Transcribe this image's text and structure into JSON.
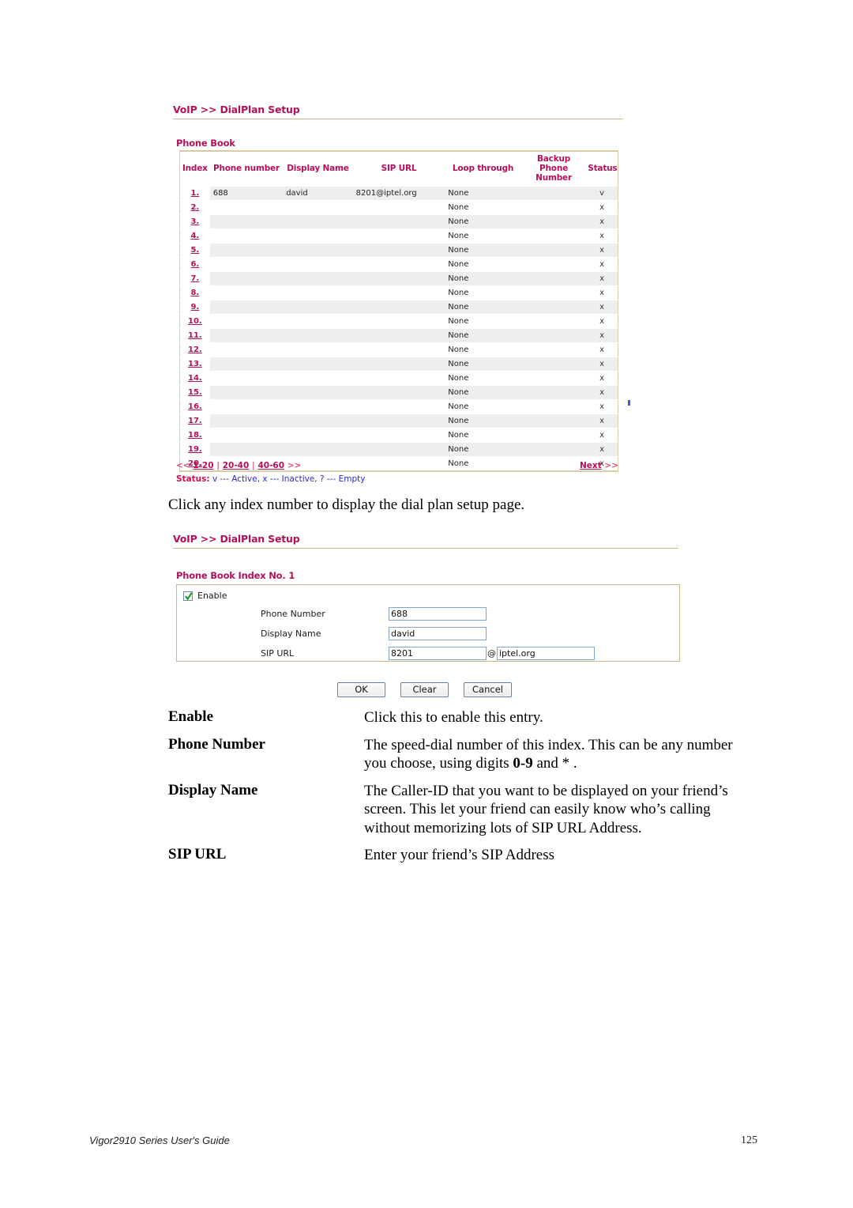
{
  "document": {
    "footer_title": "Vigor2910 Series User's Guide",
    "page_number": "125",
    "instruction": "Click any index number to display the dial plan setup page."
  },
  "list_screen": {
    "breadcrumb": "VoIP >> DialPlan Setup",
    "section_title": "Phone Book",
    "columns": [
      "Index",
      "Phone number",
      "Display Name",
      "SIP URL",
      "Loop through",
      "Backup Phone Number",
      "Status"
    ],
    "rows": [
      {
        "index": "1.",
        "phone": "688",
        "display": "david",
        "sip": "8201@iptel.org",
        "loop": "None",
        "backup": "",
        "status": "v"
      },
      {
        "index": "2.",
        "phone": "",
        "display": "",
        "sip": "",
        "loop": "None",
        "backup": "",
        "status": "x"
      },
      {
        "index": "3.",
        "phone": "",
        "display": "",
        "sip": "",
        "loop": "None",
        "backup": "",
        "status": "x"
      },
      {
        "index": "4.",
        "phone": "",
        "display": "",
        "sip": "",
        "loop": "None",
        "backup": "",
        "status": "x"
      },
      {
        "index": "5.",
        "phone": "",
        "display": "",
        "sip": "",
        "loop": "None",
        "backup": "",
        "status": "x"
      },
      {
        "index": "6.",
        "phone": "",
        "display": "",
        "sip": "",
        "loop": "None",
        "backup": "",
        "status": "x"
      },
      {
        "index": "7.",
        "phone": "",
        "display": "",
        "sip": "",
        "loop": "None",
        "backup": "",
        "status": "x"
      },
      {
        "index": "8.",
        "phone": "",
        "display": "",
        "sip": "",
        "loop": "None",
        "backup": "",
        "status": "x"
      },
      {
        "index": "9.",
        "phone": "",
        "display": "",
        "sip": "",
        "loop": "None",
        "backup": "",
        "status": "x"
      },
      {
        "index": "10.",
        "phone": "",
        "display": "",
        "sip": "",
        "loop": "None",
        "backup": "",
        "status": "x"
      },
      {
        "index": "11.",
        "phone": "",
        "display": "",
        "sip": "",
        "loop": "None",
        "backup": "",
        "status": "x"
      },
      {
        "index": "12.",
        "phone": "",
        "display": "",
        "sip": "",
        "loop": "None",
        "backup": "",
        "status": "x"
      },
      {
        "index": "13.",
        "phone": "",
        "display": "",
        "sip": "",
        "loop": "None",
        "backup": "",
        "status": "x"
      },
      {
        "index": "14.",
        "phone": "",
        "display": "",
        "sip": "",
        "loop": "None",
        "backup": "",
        "status": "x"
      },
      {
        "index": "15.",
        "phone": "",
        "display": "",
        "sip": "",
        "loop": "None",
        "backup": "",
        "status": "x"
      },
      {
        "index": "16.",
        "phone": "",
        "display": "",
        "sip": "",
        "loop": "None",
        "backup": "",
        "status": "x"
      },
      {
        "index": "17.",
        "phone": "",
        "display": "",
        "sip": "",
        "loop": "None",
        "backup": "",
        "status": "x"
      },
      {
        "index": "18.",
        "phone": "",
        "display": "",
        "sip": "",
        "loop": "None",
        "backup": "",
        "status": "x"
      },
      {
        "index": "19.",
        "phone": "",
        "display": "",
        "sip": "",
        "loop": "None",
        "backup": "",
        "status": "x"
      },
      {
        "index": "20.",
        "phone": "",
        "display": "",
        "sip": "",
        "loop": "None",
        "backup": "",
        "status": "x"
      }
    ],
    "pager": {
      "prev": "<<",
      "page1": "1-20",
      "page2": "20-40",
      "page3": "40-60",
      "more": ">>",
      "sep": "|",
      "next_label": "Next",
      "next_arrows": ">>"
    },
    "status_legend": {
      "label": "Status:",
      "text": "v --- Active, x --- Inactive, ? --- Empty"
    }
  },
  "detail_screen": {
    "breadcrumb": "VoIP >> DialPlan Setup",
    "section_title": "Phone Book Index No. 1",
    "enable_label": "Enable",
    "enable_checked": true,
    "fields": [
      {
        "label": "Phone Number",
        "value": "688"
      },
      {
        "label": "Display Name",
        "value": "david"
      },
      {
        "label": "SIP URL",
        "value": "8201",
        "at": "@",
        "domain": "iptel.org"
      }
    ],
    "buttons": [
      {
        "label": "OK"
      },
      {
        "label": "Clear"
      },
      {
        "label": "Cancel"
      }
    ]
  },
  "definitions": [
    {
      "term": "Enable",
      "lines": [
        "Click this to enable this entry."
      ]
    },
    {
      "term": "Phone Number",
      "line1_a": "The speed-dial number of this index. This can be any number",
      "line2_a": "you choose, using digits ",
      "line2_b": "0-9",
      "line2_c": " and * ."
    },
    {
      "term": "Display Name",
      "lines": [
        "The Caller-ID that you want to be displayed on your friend’s",
        "screen. This let your friend can easily know who’s calling",
        "without memorizing lots of SIP URL Address."
      ]
    },
    {
      "term": "SIP URL",
      "lines": [
        "Enter your friend’s SIP Address"
      ]
    }
  ]
}
